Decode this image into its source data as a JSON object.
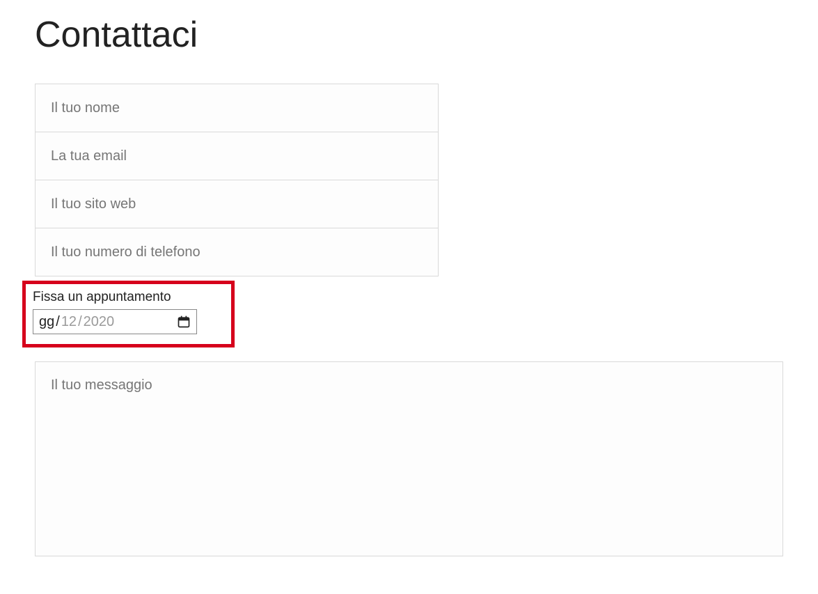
{
  "page": {
    "title": "Contattaci"
  },
  "fields": {
    "name": {
      "placeholder": "Il tuo nome",
      "value": ""
    },
    "email": {
      "placeholder": "La tua email",
      "value": ""
    },
    "website": {
      "placeholder": "Il tuo sito web",
      "value": ""
    },
    "phone": {
      "placeholder": "Il tuo numero di telefono",
      "value": ""
    }
  },
  "appointment": {
    "label": "Fissa un appuntamento",
    "day": "gg",
    "sep": "/",
    "month": "12",
    "year": "2020"
  },
  "message": {
    "placeholder": "Il tuo messaggio",
    "value": ""
  },
  "highlight_color": "#d6001c"
}
